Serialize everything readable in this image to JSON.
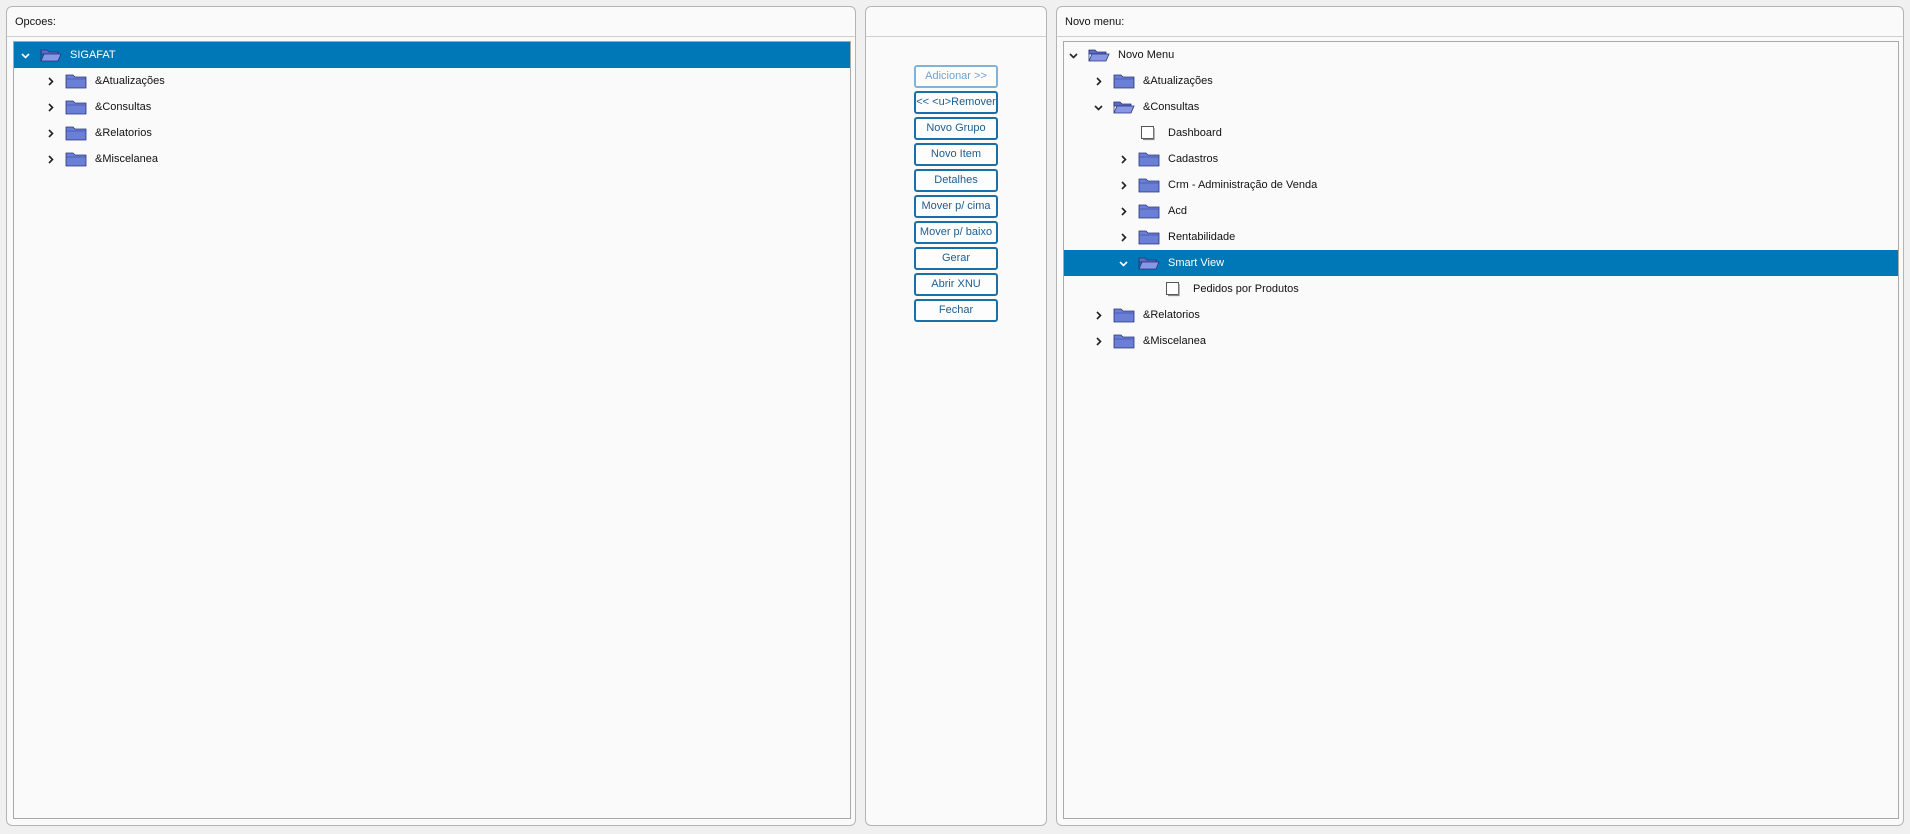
{
  "left_panel": {
    "title": "Opcoes:",
    "tree": [
      {
        "label": "SIGAFAT",
        "depth": 0,
        "expanded": true,
        "type": "folder",
        "selected": true
      },
      {
        "label": "&Atualizações",
        "depth": 1,
        "expanded": false,
        "type": "folder"
      },
      {
        "label": "&Consultas",
        "depth": 1,
        "expanded": false,
        "type": "folder"
      },
      {
        "label": "&Relatorios",
        "depth": 1,
        "expanded": false,
        "type": "folder"
      },
      {
        "label": "&Miscelanea",
        "depth": 1,
        "expanded": false,
        "type": "folder"
      }
    ]
  },
  "buttons": [
    {
      "label": "Adicionar >>",
      "disabled": true,
      "name": "adicionar-button"
    },
    {
      "label": "<< <u>Remover",
      "disabled": false,
      "name": "remover-button"
    },
    {
      "label": "Novo Grupo",
      "disabled": false,
      "name": "novo-grupo-button"
    },
    {
      "label": "Novo Item",
      "disabled": false,
      "name": "novo-item-button"
    },
    {
      "label": "Detalhes",
      "disabled": false,
      "name": "detalhes-button"
    },
    {
      "label": "Mover p/ cima",
      "disabled": false,
      "name": "mover-cima-button"
    },
    {
      "label": "Mover p/ baixo",
      "disabled": false,
      "name": "mover-baixo-button"
    },
    {
      "label": "Gerar",
      "disabled": false,
      "name": "gerar-button"
    },
    {
      "label": "Abrir XNU",
      "disabled": false,
      "name": "abrir-xnu-button"
    },
    {
      "label": "Fechar",
      "disabled": false,
      "name": "fechar-button"
    }
  ],
  "right_panel": {
    "title": "Novo menu:",
    "tree": [
      {
        "label": "Novo Menu",
        "depth": 0,
        "expanded": true,
        "type": "folder"
      },
      {
        "label": "&Atualizações",
        "depth": 1,
        "expanded": false,
        "type": "folder"
      },
      {
        "label": "&Consultas",
        "depth": 1,
        "expanded": true,
        "type": "folder"
      },
      {
        "label": "Dashboard",
        "depth": 2,
        "type": "item"
      },
      {
        "label": "Cadastros",
        "depth": 2,
        "expanded": false,
        "type": "folder"
      },
      {
        "label": "Crm - Administração de Venda",
        "depth": 2,
        "expanded": false,
        "type": "folder"
      },
      {
        "label": "Acd",
        "depth": 2,
        "expanded": false,
        "type": "folder"
      },
      {
        "label": "Rentabilidade",
        "depth": 2,
        "expanded": false,
        "type": "folder"
      },
      {
        "label": "Smart View",
        "depth": 2,
        "expanded": true,
        "type": "folder",
        "selected": true
      },
      {
        "label": "Pedidos por Produtos",
        "depth": 3,
        "type": "item"
      },
      {
        "label": "&Relatorios",
        "depth": 1,
        "expanded": false,
        "type": "folder"
      },
      {
        "label": "&Miscelanea",
        "depth": 1,
        "expanded": false,
        "type": "folder"
      }
    ]
  },
  "colors": {
    "selection": "#0077b6",
    "folder": "#6a7fd6",
    "button_border": "#1b6fa8"
  }
}
